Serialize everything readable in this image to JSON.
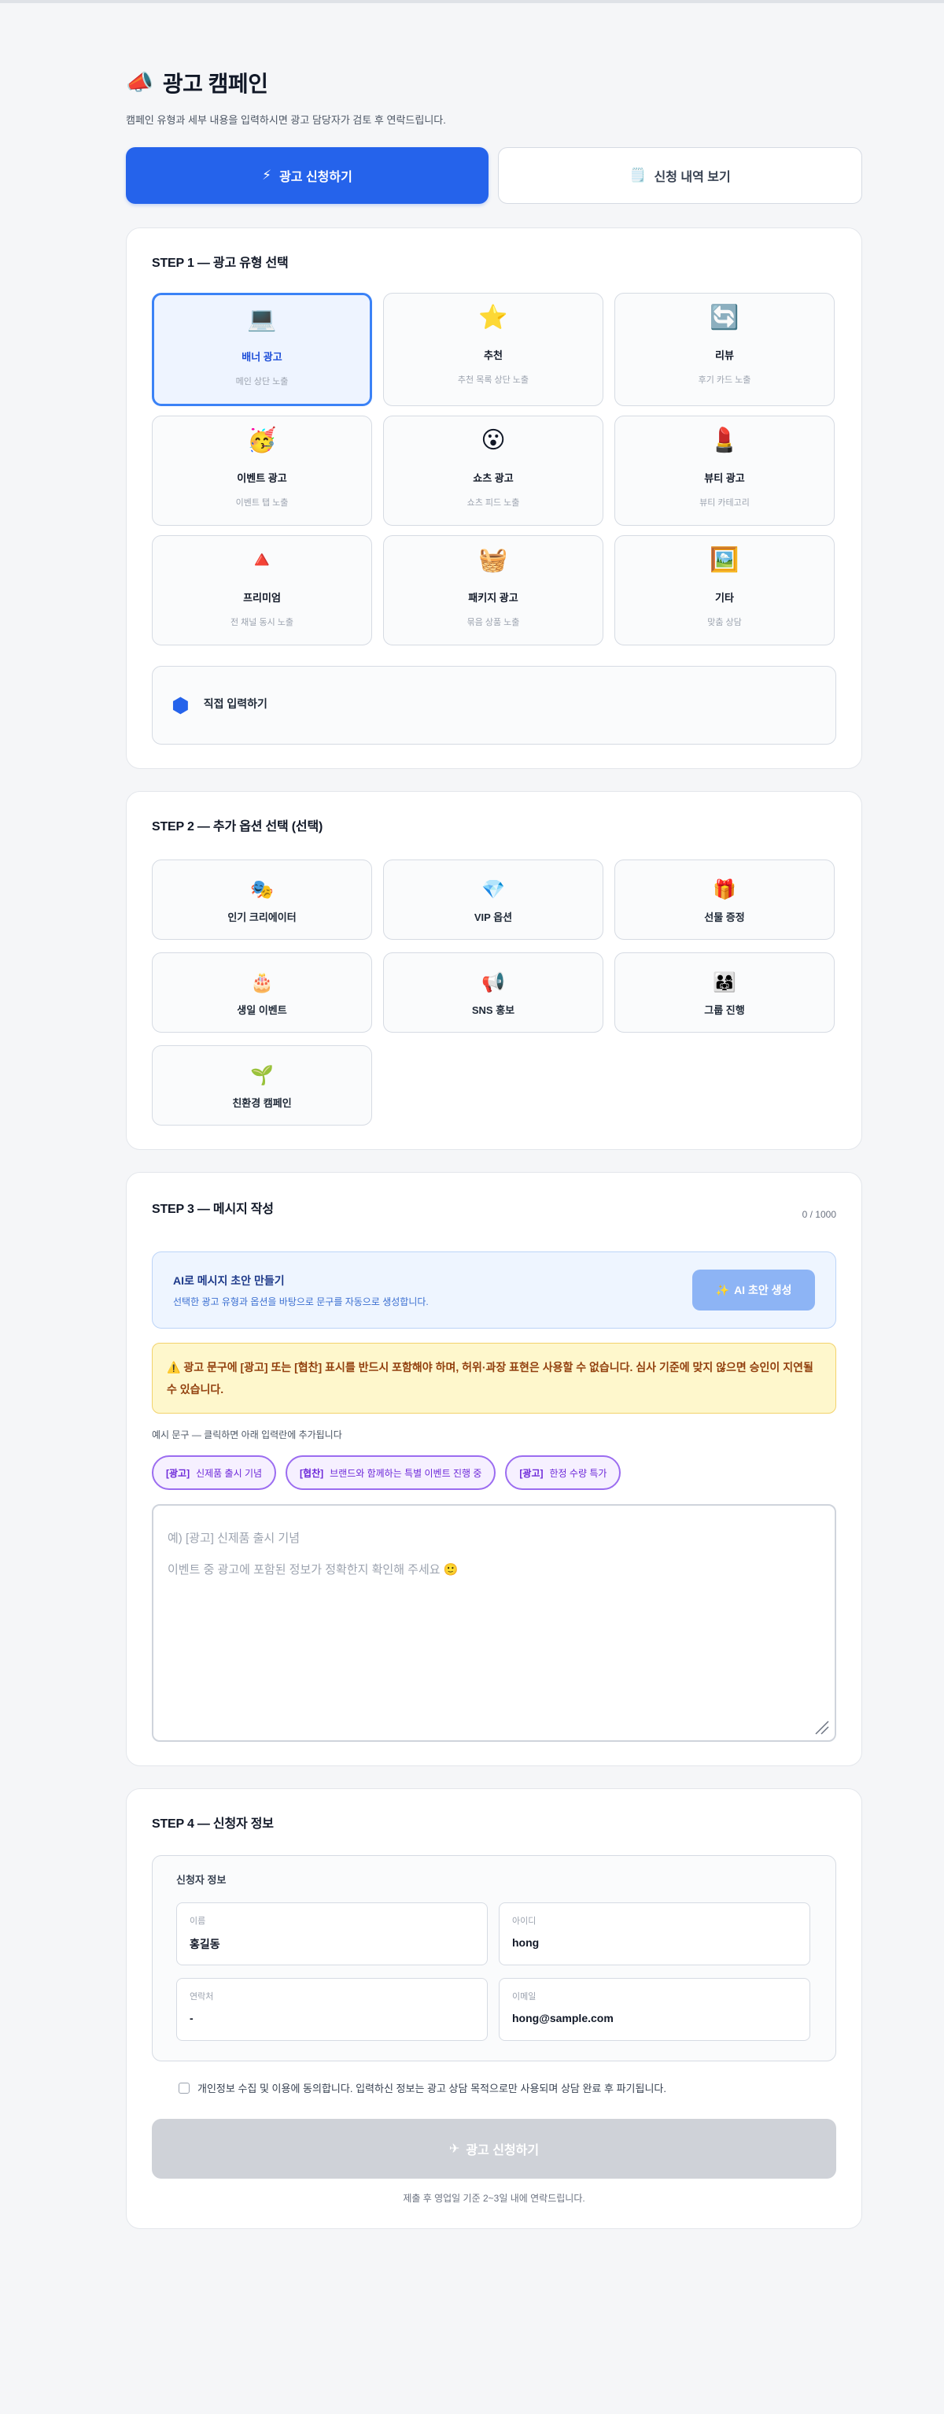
{
  "header": {
    "icon": "📣",
    "title": "광고 캠페인",
    "subtitle": "캠페인 유형과 세부 내용을 입력하시면 광고 담당자가 검토 후 연락드립니다."
  },
  "tabs": [
    {
      "icon": "⚡",
      "label": "광고 신청하기"
    },
    {
      "icon": "🗒️",
      "label": "신청 내역 보기"
    }
  ],
  "step1": {
    "title": "STEP 1 — 광고 유형 선택",
    "items": [
      {
        "icon": "💻",
        "name": "배너 광고",
        "desc": "메인 상단 노출"
      },
      {
        "icon": "⭐",
        "name": "추천",
        "desc": "추천 목록 상단 노출"
      },
      {
        "icon": "🔄",
        "name": "리뷰",
        "desc": "후기 카드 노출"
      },
      {
        "icon": "🥳",
        "name": "이벤트 광고",
        "desc": "이벤트 탭 노출"
      },
      {
        "icon": "😮",
        "name": "쇼츠 광고",
        "desc": "쇼츠 피드 노출"
      },
      {
        "icon": "💄",
        "name": "뷰티 광고",
        "desc": "뷰티 카테고리"
      },
      {
        "icon": "🔺",
        "name": "프리미엄",
        "desc": "전 채널 동시 노출"
      },
      {
        "icon": "🧺",
        "name": "패키지 광고",
        "desc": "묶음 상품 노출"
      },
      {
        "icon": "🖼️",
        "name": "기타",
        "desc": "맞춤 상담"
      }
    ],
    "custom": {
      "icon": "⬢",
      "label": "직접 입력하기"
    }
  },
  "step2": {
    "title": "STEP 2 — 추가 옵션 선택 (선택)",
    "items": [
      {
        "icon": "🎭",
        "name": "인기 크리에이터"
      },
      {
        "icon": "💎",
        "name": "VIP 옵션"
      },
      {
        "icon": "🎁",
        "name": "선물 증정"
      },
      {
        "icon": "🎂",
        "name": "생일 이벤트"
      },
      {
        "icon": "📢",
        "name": "SNS 홍보"
      },
      {
        "icon": "👨‍👩‍👧",
        "name": "그룹 진행"
      },
      {
        "icon": "🌱",
        "name": "친환경 캠페인"
      }
    ]
  },
  "step3": {
    "title": "STEP 3 — 메시지 작성",
    "counter": "0 / 1000",
    "ai": {
      "title": "AI로 메시지 초안 만들기",
      "desc": "선택한 광고 유형과 옵션을 바탕으로 문구를 자동으로 생성합니다.",
      "button_icon": "✨",
      "button_label": "AI 초안 생성"
    },
    "warning": "⚠️ 광고 문구에 [광고] 또는 [협찬] 표시를 반드시 포함해야 하며, 허위·과장 표현은 사용할 수 없습니다. 심사 기준에 맞지 않으면 승인이 지연될 수 있습니다.",
    "example_label": "예시 문구 — 클릭하면 아래 입력란에 추가됩니다",
    "chips": [
      {
        "tag": "[광고]",
        "text": "신제품 출시 기념"
      },
      {
        "tag": "[협찬]",
        "text": "브랜드와 함께하는 특별 이벤트 진행 중"
      },
      {
        "tag": "[광고]",
        "text": "한정 수량 특가"
      }
    ],
    "placeholder": "예) [광고] 신제품 출시 기념\n이벤트 중 광고에 포함된 정보가 정확한지 확인해 주세요 🙂"
  },
  "step4": {
    "title": "STEP 4 — 신청자 정보",
    "info_label": "신청자 정보",
    "fields": [
      {
        "label": "이름",
        "value": "홍길동"
      },
      {
        "label": "아이디",
        "value": "hong"
      },
      {
        "label": "연락처",
        "value": "-"
      },
      {
        "label": "이메일",
        "value": "hong@sample.com"
      }
    ],
    "consent": "개인정보 수집 및 이용에 동의합니다. 입력하신 정보는 광고 상담 목적으로만 사용되며 상담 완료 후 파기됩니다.",
    "submit_icon": "✈",
    "submit_label": "광고 신청하기",
    "note": "제출 후 영업일 기준 2~3일 내에 연락드립니다."
  }
}
